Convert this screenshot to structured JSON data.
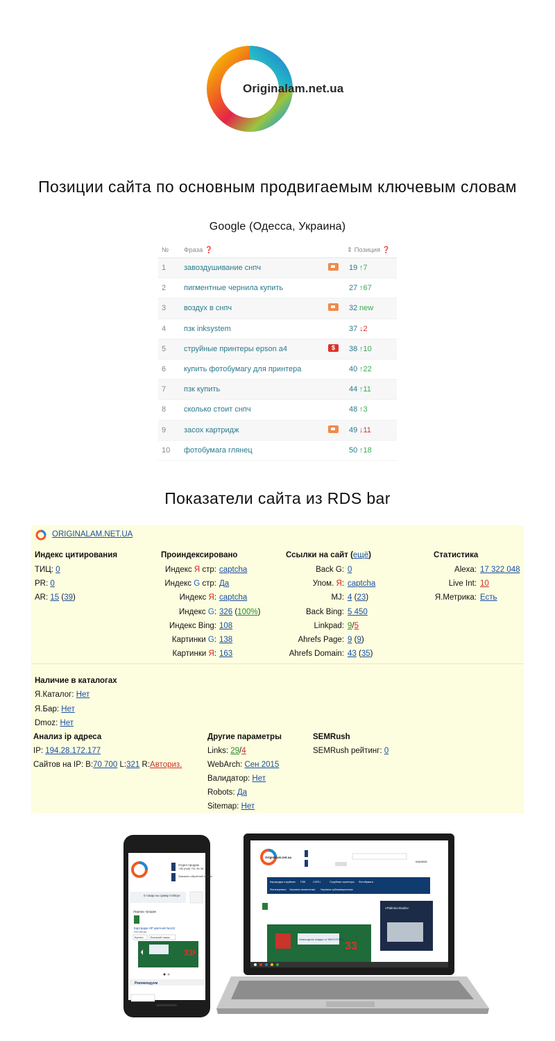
{
  "logo": {
    "text": "Originalam.net.ua"
  },
  "section1": {
    "title": "Позиции сайта по основным продвигаемым ключевым словам"
  },
  "google": {
    "subtitle": "Google (Одесса, Украина)"
  },
  "table": {
    "headers": {
      "num": "№",
      "phrase": "Фраза ❓",
      "position": "⇕ Позиция ❓"
    },
    "rows": [
      {
        "num": "1",
        "phrase": "завоздушивание снпч",
        "tag": "video",
        "position": "19",
        "dir": "up",
        "change": "7"
      },
      {
        "num": "2",
        "phrase": "пигментные чернила купить",
        "tag": "",
        "position": "27",
        "dir": "up",
        "change": "67"
      },
      {
        "num": "3",
        "phrase": "воздух в снпч",
        "tag": "video",
        "position": "32",
        "dir": "new",
        "change": "new"
      },
      {
        "num": "4",
        "phrase": "пзк inksystem",
        "tag": "",
        "position": "37",
        "dir": "down",
        "change": "2"
      },
      {
        "num": "5",
        "phrase": "струйные принтеры epson a4",
        "tag": "money",
        "position": "38",
        "dir": "up",
        "change": "10"
      },
      {
        "num": "6",
        "phrase": "купить фотобумагу для принтера",
        "tag": "",
        "position": "40",
        "dir": "up",
        "change": "22"
      },
      {
        "num": "7",
        "phrase": "пзк купить",
        "tag": "",
        "position": "44",
        "dir": "up",
        "change": "11"
      },
      {
        "num": "8",
        "phrase": "сколько стоит снпч",
        "tag": "",
        "position": "48",
        "dir": "up",
        "change": "3"
      },
      {
        "num": "9",
        "phrase": "засох картридж",
        "tag": "video",
        "position": "49",
        "dir": "down",
        "change": "11"
      },
      {
        "num": "10",
        "phrase": "фотобумага глянец",
        "tag": "",
        "position": "50",
        "dir": "up",
        "change": "18"
      }
    ]
  },
  "section2": {
    "title": "Показатели сайта из RDS bar"
  },
  "rds": {
    "site": "ORIGINALAM.NET.UA",
    "citation": {
      "title": "Индекс цитирования",
      "tic_label": "ТИЦ:",
      "tic": "0",
      "pr_label": "PR:",
      "pr": "0",
      "ar_label": "AR:",
      "ar1": "15",
      "ar2": "39"
    },
    "indexed": {
      "title": "Проиндексировано",
      "ya_pages_label_a": "Индекс ",
      "ya_pages_letter": "Я",
      "ya_pages_label_b": " стр:",
      "ya_pages": "captcha",
      "g_pages_label_a": "Индекс ",
      "g_pages_letter": "G",
      "g_pages_label_b": " стр:",
      "g_pages": "Да",
      "ya_index_label_a": "Индекс ",
      "ya_index_letter": "Я",
      "ya_index_label_b": ":",
      "ya_index": "captcha",
      "g_index_label_a": "Индекс ",
      "g_index_letter": "G",
      "g_index_label_b": ":",
      "g_index": "326",
      "g_index_pct": "100%",
      "bing_label": "Индекс Bing:",
      "bing": "108",
      "img_g_label_a": "Картинки ",
      "img_g_letter": "G",
      "img_g_label_b": ":",
      "img_g": "138",
      "img_ya_label_a": "Картинки ",
      "img_ya_letter": "Я",
      "img_ya_label_b": ":",
      "img_ya": "163"
    },
    "links": {
      "title": "Ссылки на сайт",
      "more": "ещё",
      "backg_label": "Back G:",
      "backg": "0",
      "upom_label_a": "Упом. ",
      "upom_letter": "Я",
      "upom_label_b": ":",
      "upom": "captcha",
      "mj_label": "MJ:",
      "mj1": "4",
      "mj2": "23",
      "bing_label": "Back Bing:",
      "bing": "5 450",
      "linkpad_label": "Linkpad:",
      "linkpad1": "9",
      "linkpad2": "5",
      "ahp_label": "Ahrefs Page:",
      "ahp1": "9",
      "ahp2": "9",
      "ahd_label": "Ahrefs Domain:",
      "ahd1": "43",
      "ahd2": "35"
    },
    "stats": {
      "title": "Статистика",
      "alexa_label": "Alexa:",
      "alexa": "17 322 048",
      "liveint_label": "Live Int:",
      "liveint": "10",
      "metrika_label": "Я.Метрика:",
      "metrika": "Есть"
    },
    "catalogs": {
      "title": "Наличие в каталогах",
      "yacat_label": "Я.Каталог:",
      "yacat": "Нет",
      "yabar_label": "Я.Бар:",
      "yabar": "Нет",
      "dmoz_label": "Dmoz:",
      "dmoz": "Нет"
    },
    "ip": {
      "title": "Анализ ip адреса",
      "ip_label": "IP:",
      "ip": "194.28.172.177",
      "sites_label": "Сайтов на IP: B:",
      "b": "70 700",
      "l_label": " L:",
      "l": "321",
      "r_label": " R:",
      "r": "Авториз."
    },
    "other": {
      "title": "Другие параметры",
      "links_label": "Links:",
      "links1": "29",
      "links2": "4",
      "webarch_label": "WebArch:",
      "webarch": "Сен 2015",
      "valid_label": "Валидатор:",
      "valid": "Нет",
      "robots_label": "Robots:",
      "robots": "Да",
      "sitemap_label": "Sitemap:",
      "sitemap": "Нет"
    },
    "semrush": {
      "title": "SEMRush",
      "rating_label": "SEMRush рейтинг:",
      "rating": "0"
    }
  },
  "devices": {
    "phone_dept": "Отдел продаж",
    "phone_number": "+38 (048) 701 35 39",
    "phone_order": "Заказать обратный звонок",
    "phone_cart": "0 товар на сумму 0.00грн",
    "phone_leaders": "Лидеры продаж",
    "phone_product": "Картридж HP цветной №122",
    "phone_price": "200.00грн",
    "phone_buy": "Купить",
    "phone_quick": "Быстрый заказ",
    "phone_recommend": "Рекомендуем",
    "laptop_logo": "Originalam.net.ua",
    "laptop_menu": [
      "Картриджи струйные",
      "ПЗК",
      "СНПЧ",
      "Струйные принтеры",
      "Фотобумага",
      "Фотачернила",
      "Чернила пигментные",
      "Чернила сублимационные"
    ],
    "laptop_cart": "корзина",
    "laptop_banner": "Новогодние скидки от INKSYSTEM",
    "laptop_banner_pct": "33",
    "laptop_agency": "«Palmira-Studio»"
  }
}
